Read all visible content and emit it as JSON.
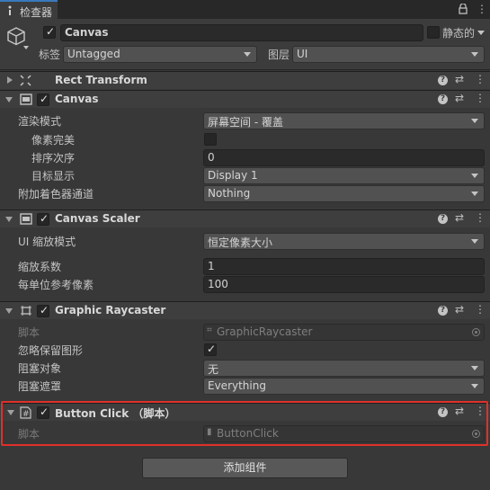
{
  "window": {
    "tab_label": "检查器",
    "lock_icon": "lock-icon",
    "menu_icon": "kebab-menu-icon"
  },
  "gameobject": {
    "name": "Canvas",
    "active": true,
    "static_label": "静态的",
    "tag_label": "标签",
    "tag_value": "Untagged",
    "layer_label": "图层",
    "layer_value": "UI"
  },
  "components": {
    "rect_transform": {
      "title": "Rect Transform"
    },
    "canvas": {
      "title": "Canvas",
      "render_mode_label": "渲染模式",
      "render_mode_value": "屏幕空间 - 覆盖",
      "pixel_perfect_label": "像素完美",
      "sort_order_label": "排序次序",
      "sort_order_value": "0",
      "target_display_label": "目标显示",
      "target_display_value": "Display 1",
      "additional_shader_label": "附加着色器通道",
      "additional_shader_value": "Nothing"
    },
    "canvas_scaler": {
      "title": "Canvas Scaler",
      "ui_scale_mode_label": "UI 缩放模式",
      "ui_scale_mode_value": "恒定像素大小",
      "scale_factor_label": "缩放系数",
      "scale_factor_value": "1",
      "ref_pixels_label": "每单位参考像素",
      "ref_pixels_value": "100"
    },
    "graphic_raycaster": {
      "title": "Graphic Raycaster",
      "script_label": "脚本",
      "script_value": "GraphicRaycaster",
      "ignore_reversed_label": "忽略保留图形",
      "ignore_reversed_checked": true,
      "blocking_objects_label": "阻塞对象",
      "blocking_objects_value": "无",
      "blocking_mask_label": "阻塞遮罩",
      "blocking_mask_value": "Everything"
    },
    "button_click": {
      "title": "Button Click （脚本）",
      "script_label": "脚本",
      "script_value": "ButtonClick"
    }
  },
  "add_component_label": "添加组件",
  "colors": {
    "highlight": "#e0302a",
    "background": "#383838",
    "accent": "#3a79bb"
  }
}
